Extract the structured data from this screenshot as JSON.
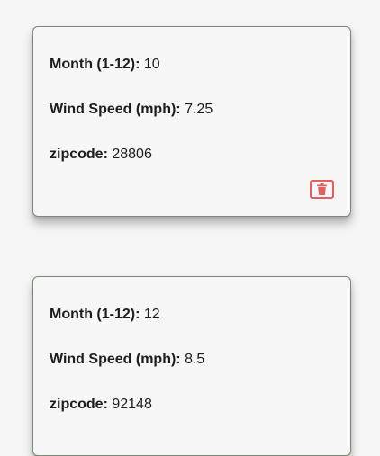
{
  "cards": [
    {
      "month_label": "Month (1-12):",
      "month_value": "10",
      "wind_label": "Wind Speed (mph):",
      "wind_value": "7.25",
      "zip_label": "zipcode:",
      "zip_value": "28806",
      "delete_icon": "trash-icon"
    },
    {
      "month_label": "Month (1-12):",
      "month_value": "12",
      "wind_label": "Wind Speed (mph):",
      "wind_value": "8.5",
      "zip_label": "zipcode:",
      "zip_value": "92148"
    }
  ],
  "colors": {
    "card_border": "#7a8a76",
    "delete_accent": "#e0605e"
  }
}
